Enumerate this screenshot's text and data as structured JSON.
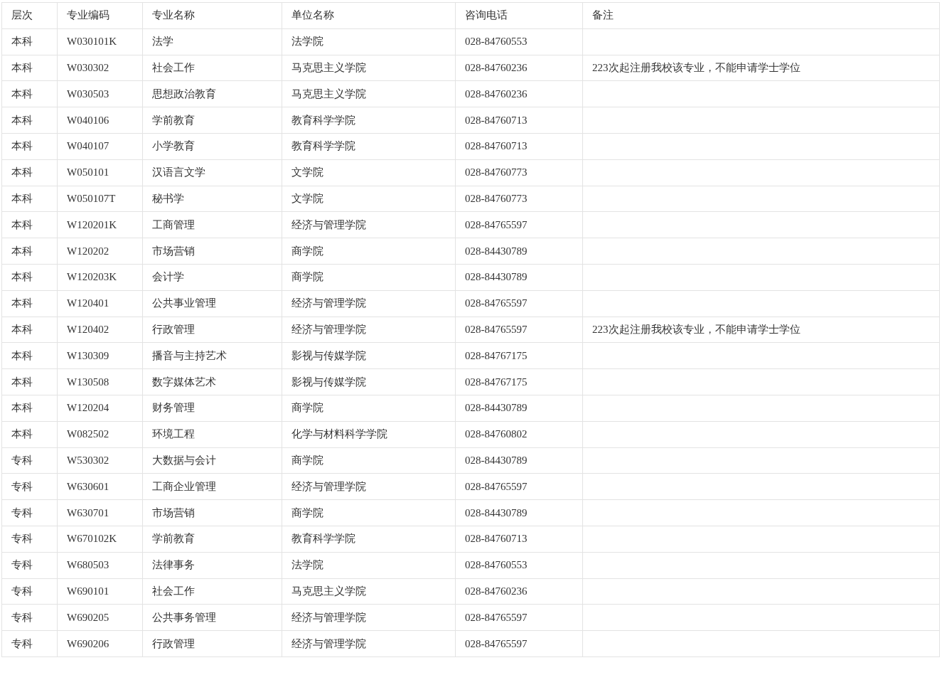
{
  "table": {
    "columns": [
      "层次",
      "专业编码",
      "专业名称",
      "单位名称",
      "咨询电话",
      "备注"
    ],
    "rows": [
      [
        "本科",
        "W030101K",
        "法学",
        "法学院",
        "028-84760553"
      ],
      [
        "本科",
        "W030302",
        "社会工作",
        "马克思主义学院",
        "028-84760236",
        "223次起注册我校该专业，不能申请学士学位"
      ],
      [
        "本科",
        "W030503",
        "思想政治教育",
        "马克思主义学院",
        "028-84760236"
      ],
      [
        "本科",
        "W040106",
        "学前教育",
        "教育科学学院",
        "028-84760713"
      ],
      [
        "本科",
        "W040107",
        "小学教育",
        "教育科学学院",
        "028-84760713"
      ],
      [
        "本科",
        "W050101",
        "汉语言文学",
        "文学院",
        "028-84760773"
      ],
      [
        "本科",
        "W050107T",
        "秘书学",
        "文学院",
        "028-84760773"
      ],
      [
        "本科",
        "W120201K",
        "工商管理",
        "经济与管理学院",
        "028-84765597"
      ],
      [
        "本科",
        "W120202",
        "市场营销",
        "商学院",
        "028-84430789"
      ],
      [
        "本科",
        "W120203K",
        "会计学",
        "商学院",
        "028-84430789"
      ],
      [
        "本科",
        "W120401",
        "公共事业管理",
        "经济与管理学院",
        "028-84765597"
      ],
      [
        "本科",
        "W120402",
        "行政管理",
        "经济与管理学院",
        "028-84765597",
        "223次起注册我校该专业，不能申请学士学位"
      ],
      [
        "本科",
        "W130309",
        "播音与主持艺术",
        "影视与传媒学院",
        "028-84767175"
      ],
      [
        "本科",
        "W130508",
        "数字媒体艺术",
        "影视与传媒学院",
        "028-84767175"
      ],
      [
        "本科",
        "W120204",
        "财务管理",
        "商学院",
        "028-84430789"
      ],
      [
        "本科",
        "W082502",
        "环境工程",
        "化学与材料科学学院",
        "028-84760802"
      ],
      [
        "专科",
        "W530302",
        "大数据与会计",
        "商学院",
        "028-84430789"
      ],
      [
        "专科",
        "W630601",
        "工商企业管理",
        "经济与管理学院",
        "028-84765597"
      ],
      [
        "专科",
        "W630701",
        "市场营销",
        "商学院",
        "028-84430789"
      ],
      [
        "专科",
        "W670102K",
        "学前教育",
        "教育科学学院",
        "028-84760713"
      ],
      [
        "专科",
        "W680503",
        "法律事务",
        "法学院",
        "028-84760553"
      ],
      [
        "专科",
        "W690101",
        "社会工作",
        "马克思主义学院",
        "028-84760236"
      ],
      [
        "专科",
        "W690205",
        "公共事务管理",
        "经济与管理学院",
        "028-84765597"
      ],
      [
        "专科",
        "W690206",
        "行政管理",
        "经济与管理学院",
        "028-84765597"
      ]
    ]
  }
}
